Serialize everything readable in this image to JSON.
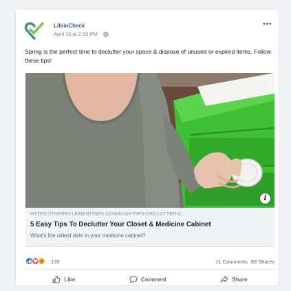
{
  "post": {
    "page_name": "LifeinCheck",
    "timestamp": "April 10 at 2:55 PM",
    "separator": "·",
    "caption": "Spring is the perfect time to declutter your space & dispose of unused or expired items. Follow these tips!"
  },
  "link_preview": {
    "domain": "HTTPS://THREECLEMENTINES.COM/EASY-TIPS-DECLUTTER-C...",
    "title": "5 Easy Tips To Declutter Your Closet & Medicine Cabinet",
    "description": "What's the oldest date in your medicine cabinet?",
    "info_label": "i"
  },
  "engagement": {
    "reaction_count": "135",
    "comments": "11 Comments",
    "shares": "88 Shares"
  },
  "actions": {
    "like": "Like",
    "comment": "Comment",
    "share": "Share"
  },
  "icons": {
    "avatar": "heart-check-logo-icon",
    "privacy": "globe-icon",
    "more": "more-options-icon",
    "reactions": [
      "like-reaction-icon",
      "love-reaction-icon",
      "wow-reaction-icon"
    ]
  },
  "colors": {
    "page_name": "#385898",
    "logo": "#3f8f98",
    "cabinet_green": "#3fc23a",
    "like_blue": "#1877f2",
    "love_red": "#f33e58",
    "wow_yellow": "#f7b125"
  }
}
